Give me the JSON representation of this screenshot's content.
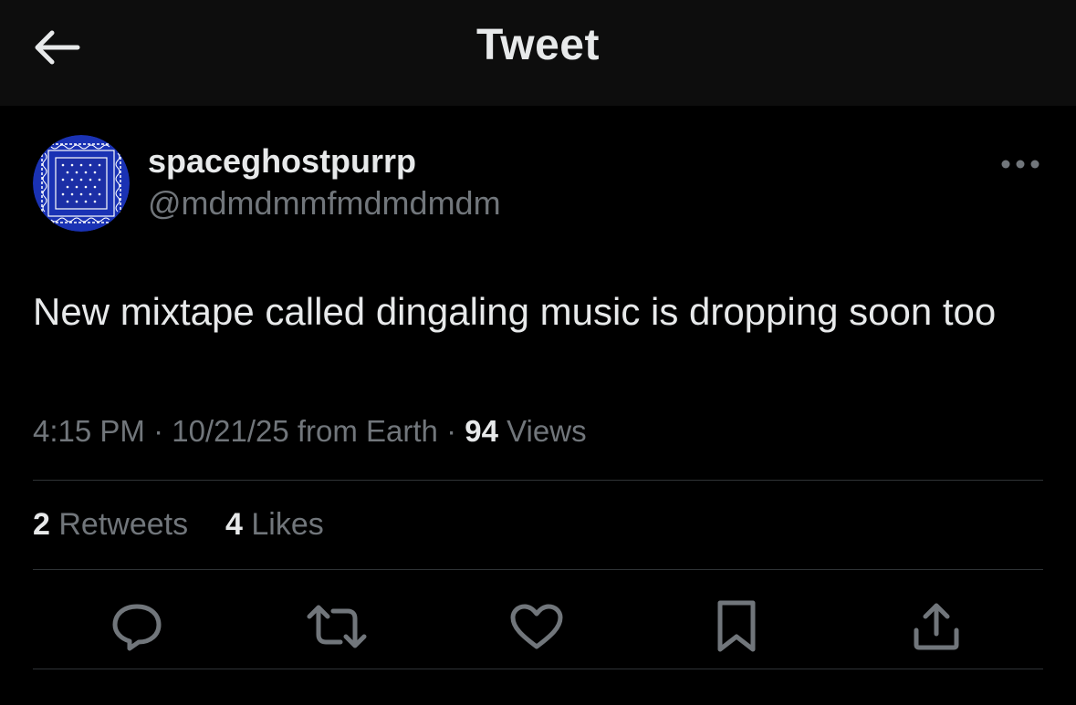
{
  "header": {
    "title": "Tweet",
    "back_icon": "arrow-left-icon"
  },
  "author": {
    "display_name": "spaceghostpurrp",
    "handle": "@mdmdmmfmdmdmdm",
    "avatar_colors": {
      "background": "#1a32b4",
      "pattern": "#ffffff"
    }
  },
  "tweet": {
    "text": "New mixtape called dingaling music is dropping soon too"
  },
  "meta": {
    "time": "4:15 PM",
    "sep1": " · ",
    "date": "10/21/25",
    "source": " from Earth",
    "sep2": " · ",
    "views_count": "94",
    "views_label": " Views"
  },
  "stats": {
    "retweets_count": "2",
    "retweets_label": " Retweets",
    "likes_count": "4",
    "likes_label": " Likes"
  },
  "actions": {
    "icons": [
      "reply-icon",
      "retweet-icon",
      "like-icon",
      "bookmark-icon",
      "share-icon"
    ],
    "icon_color": "#71767b"
  },
  "colors": {
    "background": "#000000",
    "topbar": "#0d0d0d",
    "primary_text": "#e7e9ea",
    "secondary_text": "#71767b",
    "divider": "#2f3336"
  }
}
